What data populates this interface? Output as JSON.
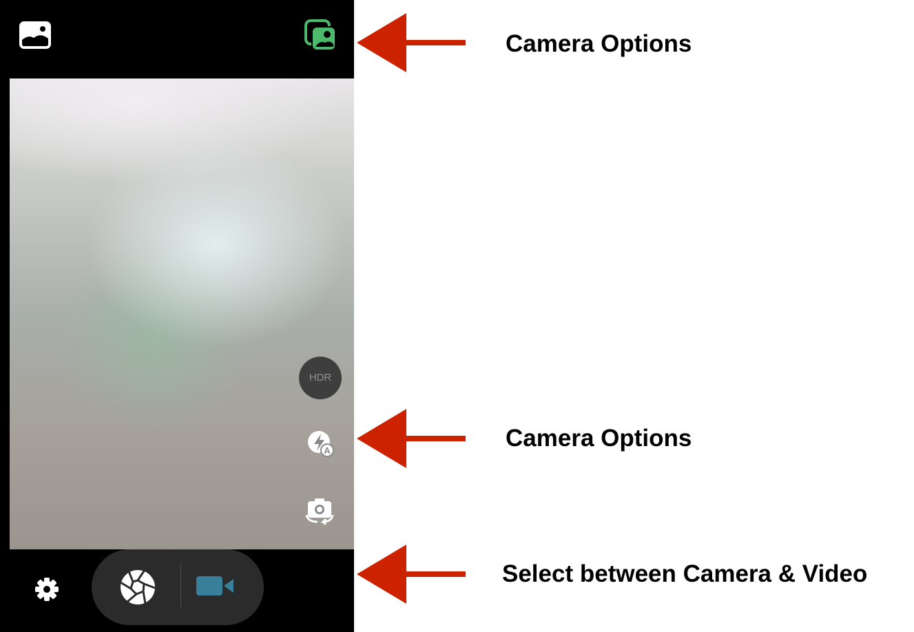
{
  "camera_ui": {
    "hdr_label": "HDR",
    "colors": {
      "background": "#000000",
      "switch_camera_icon": "#4cb96d",
      "video_icon": "#3a7f99",
      "hdr_button_bg": "#3e3e3e"
    },
    "icons": {
      "gallery": "gallery-icon",
      "switch_camera": "switch-camera-icon",
      "flash": "flash-auto-icon",
      "flip": "flip-camera-icon",
      "settings": "gear-icon",
      "shutter": "shutter-icon",
      "video": "video-camera-icon"
    }
  },
  "annotations": {
    "arrow_color": "#cc2200",
    "items": [
      {
        "label": "Camera Options"
      },
      {
        "label": "Camera Options"
      },
      {
        "label": "Select between Camera & Video"
      }
    ]
  }
}
